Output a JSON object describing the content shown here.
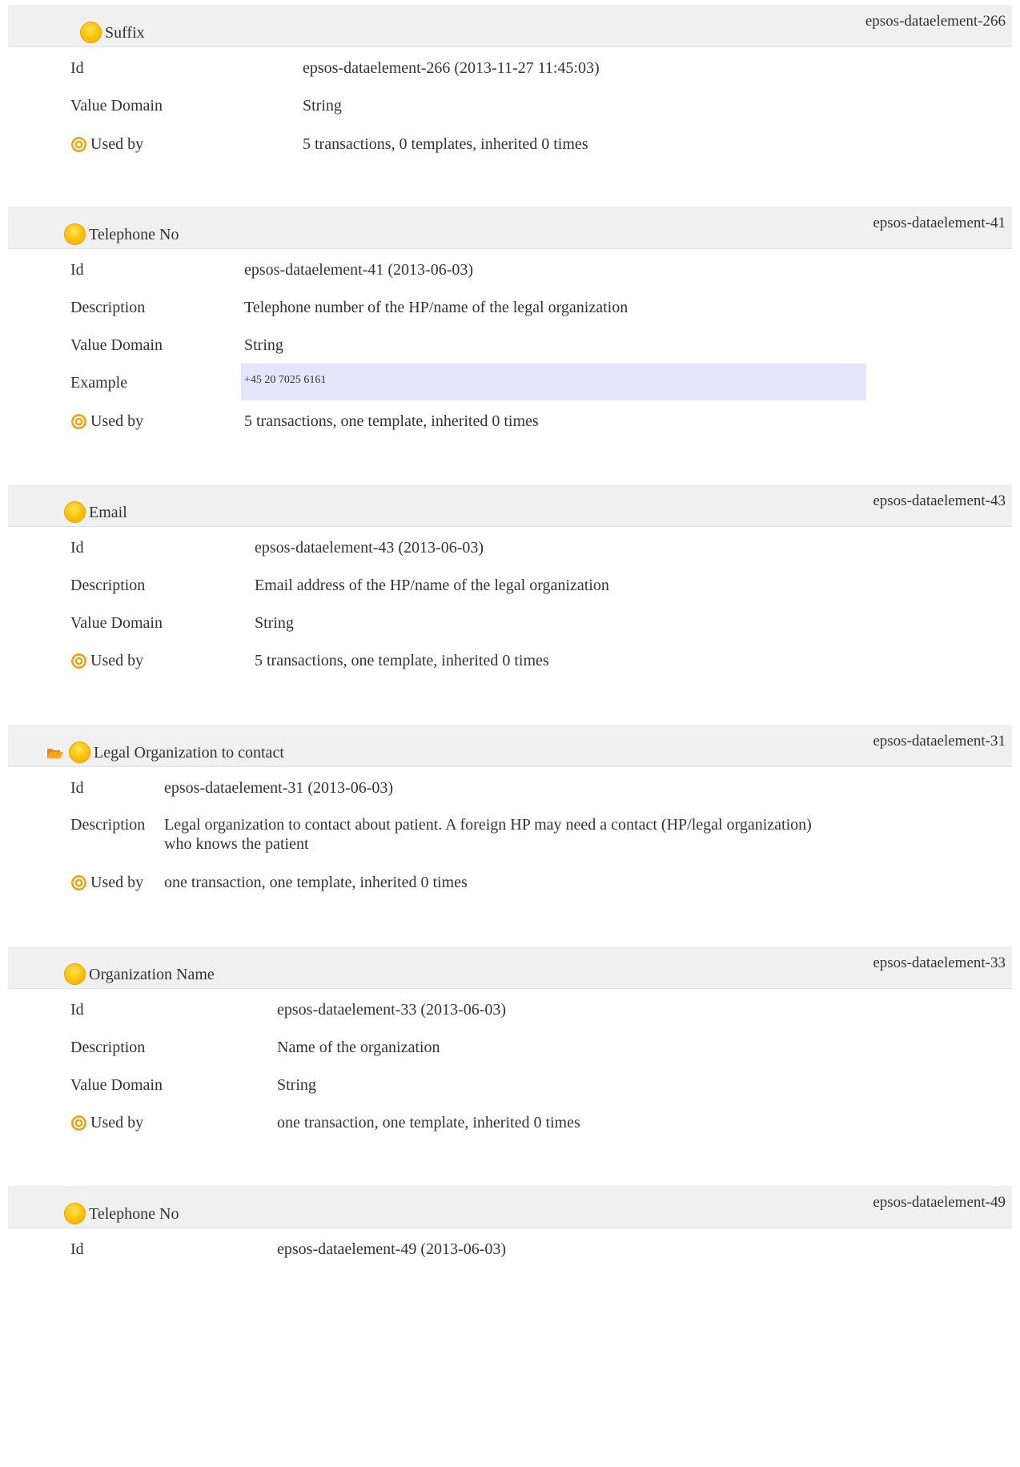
{
  "labels": {
    "id": "Id",
    "description": "Description",
    "value_domain": "Value Domain",
    "example": "Example",
    "used_by": "Used by"
  },
  "colors": {
    "header_bg": "#f0f0f0",
    "example_bg": "#e6e6fa",
    "icon": "#ffc000",
    "target_icon": "#f5a000",
    "folder_icon": "#f08a00"
  },
  "sections": [
    {
      "title": "Suffix",
      "ident": "epsos-dataelement-266",
      "id": "epsos-dataelement-266 (2013-11-27 11:45:03)",
      "value_domain": "String",
      "used_by": "5 transactions, 0 templates, inherited 0 times"
    },
    {
      "title": "Telephone No",
      "ident": "epsos-dataelement-41",
      "id": "epsos-dataelement-41 (2013-06-03)",
      "description": "Telephone number of the HP/name of the legal organization",
      "value_domain": "String",
      "example": "+45 20 7025 6161",
      "used_by": "5 transactions, one template, inherited 0 times"
    },
    {
      "title": "Email",
      "ident": "epsos-dataelement-43",
      "id": "epsos-dataelement-43 (2013-06-03)",
      "description": "Email address of the HP/name of the legal organization",
      "value_domain": "String",
      "used_by": "5 transactions, one template, inherited 0 times"
    },
    {
      "title": "Legal Organization to contact",
      "ident": "epsos-dataelement-31",
      "id": "epsos-dataelement-31 (2013-06-03)",
      "description_line1": "Legal organization to contact about patient. A foreign HP may need a contact (HP/legal organization)",
      "description_line2": "who knows the patient",
      "used_by": "one transaction, one template, inherited 0 times"
    },
    {
      "title": "Organization Name",
      "ident": "epsos-dataelement-33",
      "id": "epsos-dataelement-33 (2013-06-03)",
      "description": "Name of the organization",
      "value_domain": "String",
      "used_by": "one transaction, one template, inherited 0 times"
    },
    {
      "title": "Telephone No",
      "ident": "epsos-dataelement-49",
      "id": "epsos-dataelement-49 (2013-06-03)"
    }
  ]
}
